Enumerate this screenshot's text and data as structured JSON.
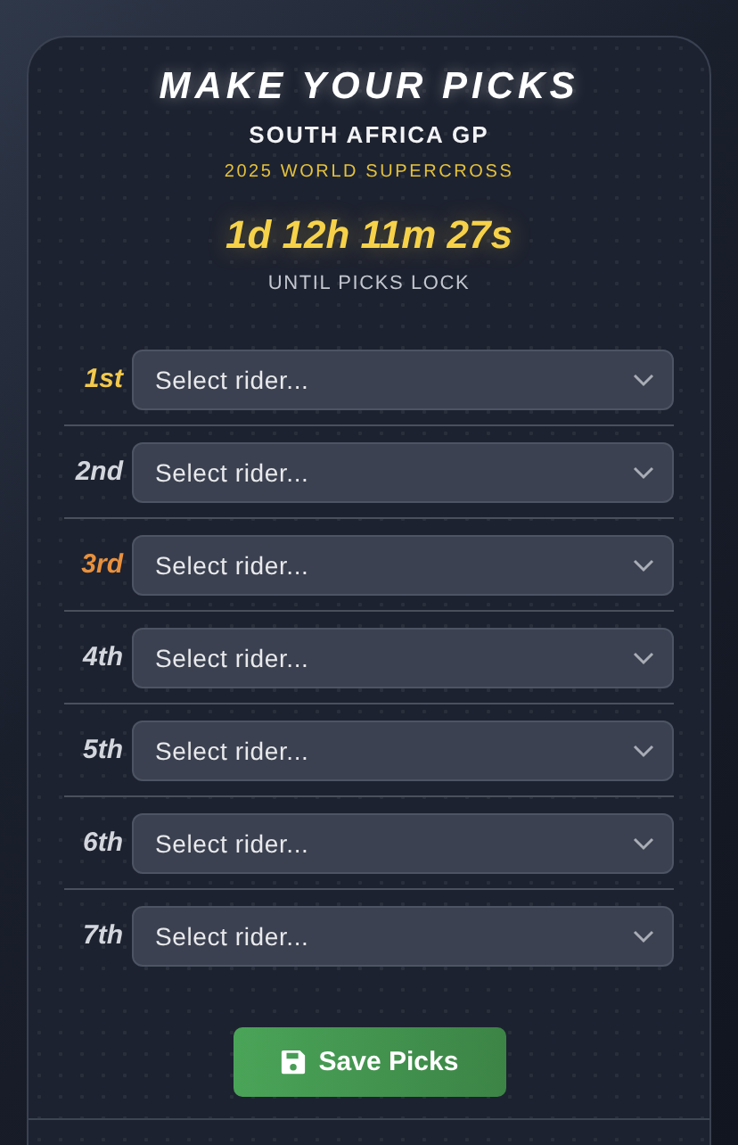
{
  "header": {
    "title": "MAKE YOUR PICKS",
    "event": "SOUTH AFRICA GP",
    "series": "2025 WORLD SUPERCROSS",
    "countdown": "1d 12h 11m 27s",
    "countdown_caption": "UNTIL PICKS LOCK"
  },
  "picks": [
    {
      "place": "1st",
      "color": "#f2c94c",
      "placeholder": "Select rider..."
    },
    {
      "place": "2nd",
      "color": "#d3d6dc",
      "placeholder": "Select rider..."
    },
    {
      "place": "3rd",
      "color": "#e8913e",
      "placeholder": "Select rider..."
    },
    {
      "place": "4th",
      "color": "#d3d6dc",
      "placeholder": "Select rider..."
    },
    {
      "place": "5th",
      "color": "#d3d6dc",
      "placeholder": "Select rider..."
    },
    {
      "place": "6th",
      "color": "#d3d6dc",
      "placeholder": "Select rider..."
    },
    {
      "place": "7th",
      "color": "#d3d6dc",
      "placeholder": "Select rider..."
    }
  ],
  "save_button": {
    "label": "Save Picks"
  }
}
